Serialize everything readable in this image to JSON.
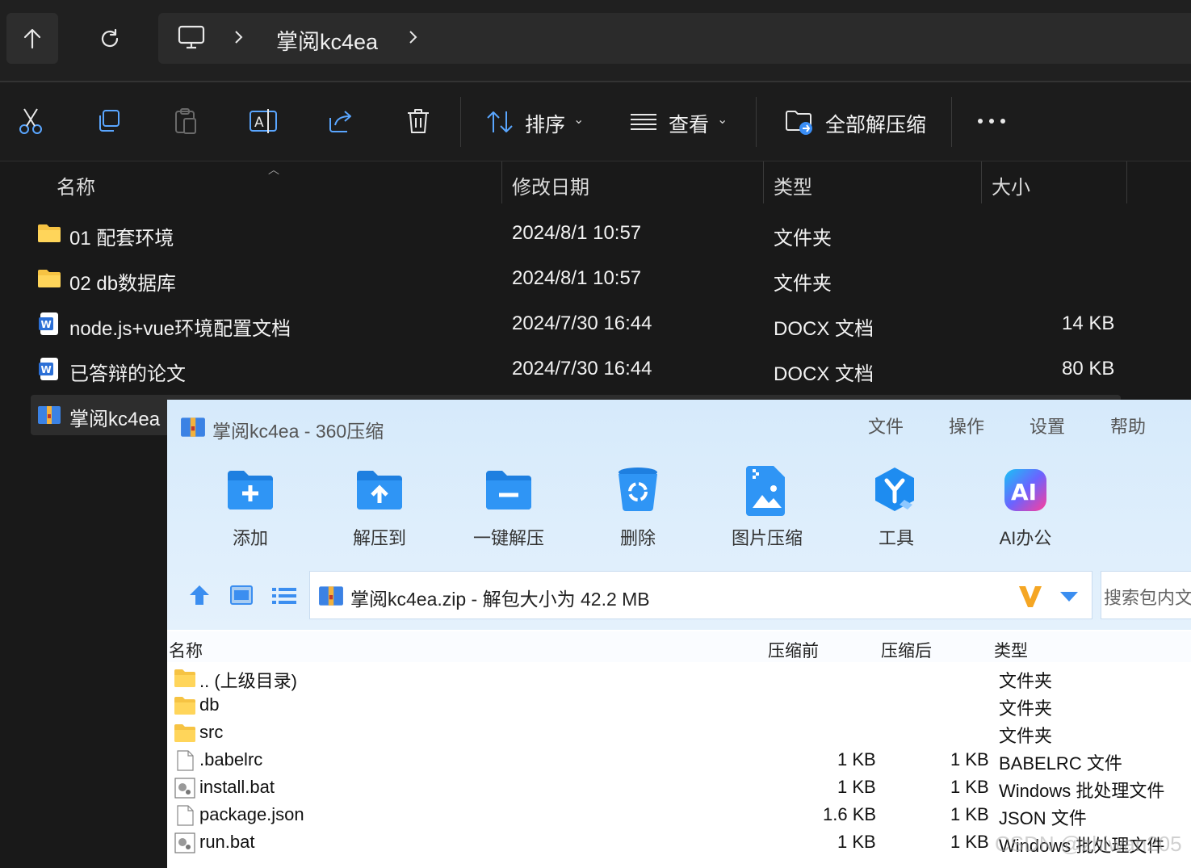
{
  "explorer": {
    "breadcrumb": "掌阅kc4ea",
    "commands": {
      "sort": "排序",
      "view": "查看",
      "extract_all": "全部解压缩"
    },
    "columns": {
      "name": "名称",
      "modified": "修改日期",
      "type": "类型",
      "size": "大小"
    },
    "rows": [
      {
        "name": "01 配套环境",
        "modified": "2024/8/1 10:57",
        "type": "文件夹",
        "size": "",
        "icon": "folder-icon"
      },
      {
        "name": "02 db数据库",
        "modified": "2024/8/1 10:57",
        "type": "文件夹",
        "size": "",
        "icon": "folder-icon"
      },
      {
        "name": "node.js+vue环境配置文档",
        "modified": "2024/7/30 16:44",
        "type": "DOCX 文档",
        "size": "14 KB",
        "icon": "word-doc-icon"
      },
      {
        "name": "已答辩的论文",
        "modified": "2024/7/30 16:44",
        "type": "DOCX 文档",
        "size": "80 KB",
        "icon": "word-doc-icon"
      },
      {
        "name": "掌阅kc4ea",
        "modified": "",
        "type": "",
        "size": "",
        "icon": "zip-archive-icon"
      }
    ]
  },
  "zip_window": {
    "title": "掌阅kc4ea - 360压缩",
    "menu": [
      "文件",
      "操作",
      "设置",
      "帮助"
    ],
    "tools": [
      "添加",
      "解压到",
      "一键解压",
      "删除",
      "图片压缩",
      "工具",
      "AI办公"
    ],
    "ai_badge": "AI",
    "path": "掌阅kc4ea.zip - 解包大小为 42.2 MB",
    "search_placeholder": "搜索包内文",
    "columns": {
      "name": "名称",
      "before": "压缩前",
      "after": "压缩后",
      "type": "类型"
    },
    "rows": [
      {
        "name": ".. (上级目录)",
        "before": "",
        "after": "",
        "type": "文件夹",
        "icon": "folder-icon"
      },
      {
        "name": "db",
        "before": "",
        "after": "",
        "type": "文件夹",
        "icon": "folder-icon"
      },
      {
        "name": "src",
        "before": "",
        "after": "",
        "type": "文件夹",
        "icon": "folder-icon"
      },
      {
        "name": ".babelrc",
        "before": "1 KB",
        "after": "1 KB",
        "type": "BABELRC 文件",
        "icon": "file-icon"
      },
      {
        "name": "install.bat",
        "before": "1 KB",
        "after": "1 KB",
        "type": "Windows 批处理文件",
        "icon": "bat-file-icon"
      },
      {
        "name": "package.json",
        "before": "1.6 KB",
        "after": "1 KB",
        "type": "JSON 文件",
        "icon": "file-icon"
      },
      {
        "name": "run.bat",
        "before": "1 KB",
        "after": "1 KB",
        "type": "Windows 批处理文件",
        "icon": "bat-file-icon"
      }
    ]
  },
  "watermark": "CSDN @zhiwan205",
  "colors": {
    "folder": "#f6c343",
    "accent_blue": "#1e7fe0",
    "word_blue": "#2b6fd6"
  }
}
